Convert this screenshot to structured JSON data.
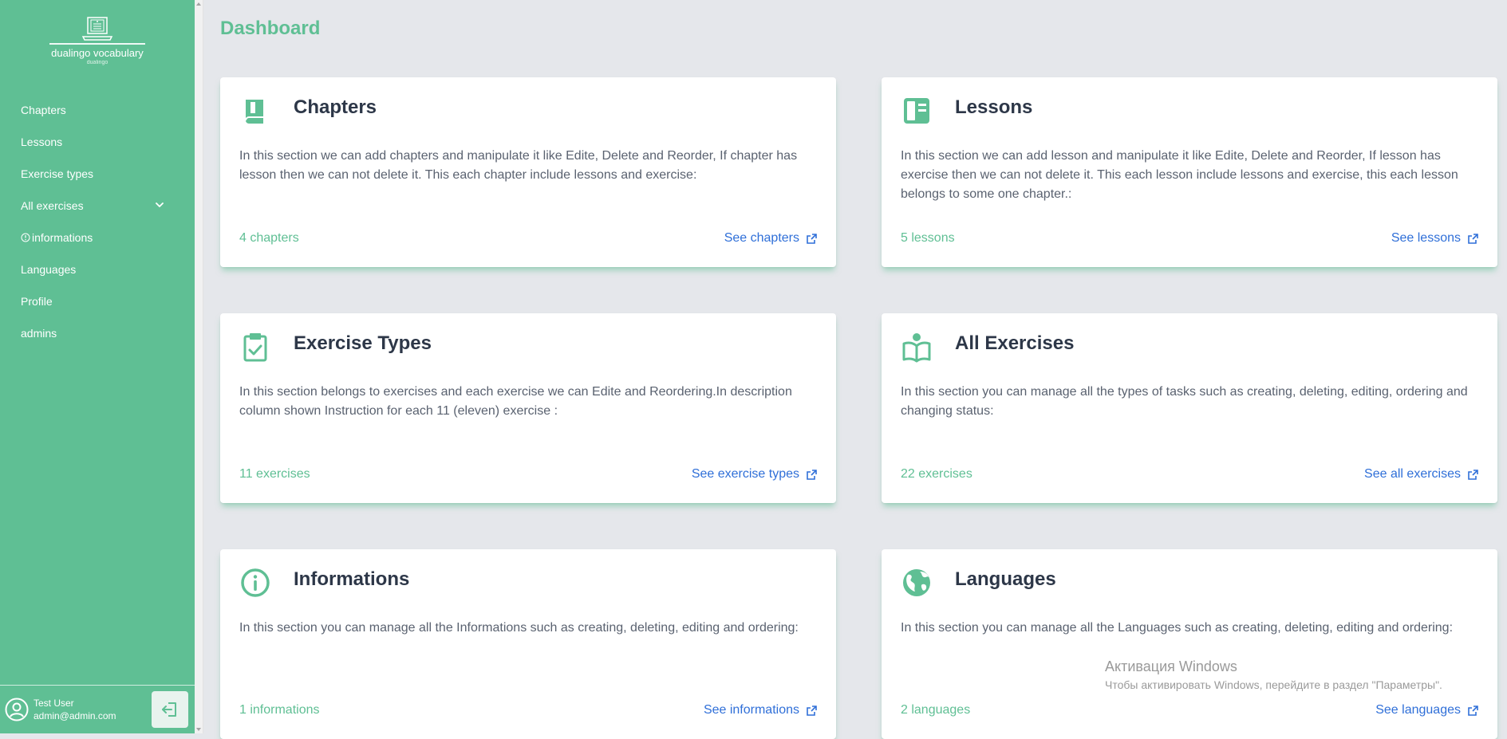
{
  "brand": {
    "name": "dualingo vocabulary",
    "sub": "dualingo"
  },
  "nav": {
    "items": [
      {
        "label": "Chapters"
      },
      {
        "label": "Lessons"
      },
      {
        "label": "Exercise types"
      },
      {
        "label": "All exercises"
      },
      {
        "label": "informations"
      },
      {
        "label": "Languages"
      },
      {
        "label": "Profile"
      },
      {
        "label": "admins"
      }
    ]
  },
  "user": {
    "name": "Test User",
    "email": "admin@admin.com"
  },
  "page": {
    "title": "Dashboard"
  },
  "cards": [
    {
      "title": "Chapters",
      "icon": "book-icon",
      "description": "In this section we can add chapters and manipulate it like Edite, Delete and Reorder, If chapter has lesson then we can not delete it. This each chapter include lessons and exercise:",
      "count": "4 chapters",
      "link": "See  chapters"
    },
    {
      "title": "Lessons",
      "icon": "book-open-page-icon",
      "description": "In this section we can add lesson and manipulate it like Edite, Delete and Reorder, If lesson has exercise then we can not delete it. This each lesson include lessons and exercise, this each lesson belongs to some one chapter.:",
      "count": "5 lessons",
      "link": "See  lessons"
    },
    {
      "title": "Exercise Types",
      "icon": "clipboard-check-icon",
      "description": "In this section belongs to exercises and each exercise we can Edite and Reordering.In description column shown Instruction for each 11 (eleven) exercise :",
      "count": "11 exercises",
      "link": "See  exercise types"
    },
    {
      "title": "All Exercises",
      "icon": "reader-icon",
      "description": "In this section you can manage all the types of tasks such as creating, deleting, editing, ordering and changing status:",
      "count": "22 exercises",
      "link": "See  all exercises"
    },
    {
      "title": "Informations",
      "icon": "info-circle-icon",
      "description": "In this section you can manage all the Informations such as creating, deleting, editing and ordering:",
      "count": "1 informations",
      "link": "See  informations"
    },
    {
      "title": "Languages",
      "icon": "globe-icon",
      "description": "In this section you can manage all the Languages such as creating, deleting, editing and ordering:",
      "count": "2 languages",
      "link": "See  languages"
    }
  ],
  "watermark": {
    "line1": "Активация Windows",
    "line2": "Чтобы активировать Windows, перейдите в раздел \"Параметры\"."
  },
  "colors": {
    "accent": "#5fbf94",
    "link": "#2f6fd8",
    "title": "#2d3748",
    "background": "#e5e7eb"
  }
}
